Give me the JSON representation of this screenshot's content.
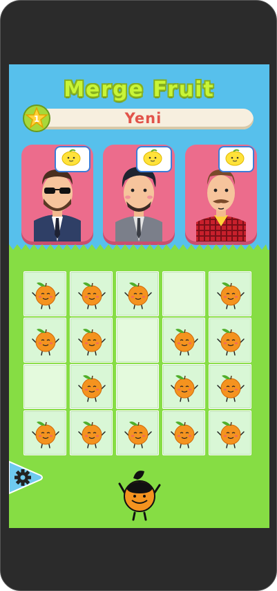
{
  "game": {
    "title": "Merge Fruit",
    "level_number": "1",
    "level_label": "Yeni"
  },
  "customers": [
    {
      "name": "customer-sunglasses",
      "wants": "lemon"
    },
    {
      "name": "customer-dark-hair",
      "wants": "lemon"
    },
    {
      "name": "customer-plaid",
      "wants": "lemon"
    }
  ],
  "board": {
    "columns": 5,
    "rows": 4,
    "cells": [
      [
        "orange",
        "orange",
        "orange",
        "empty",
        "orange"
      ],
      [
        "orange",
        "orange",
        "empty",
        "orange",
        "orange"
      ],
      [
        "empty",
        "orange",
        "empty",
        "orange",
        "orange"
      ],
      [
        "orange",
        "orange",
        "orange",
        "orange",
        "orange"
      ]
    ]
  },
  "icons": {
    "settings": "gear-icon",
    "level_badge": "star-icon",
    "fruit": "orange-icon",
    "order": "lemon-icon"
  },
  "colors": {
    "sky": "#57c0ec",
    "grass": "#86dd44",
    "title": "#c8f536",
    "card": "#ec6c8c",
    "cell": "#d9f7d6",
    "level_text": "#e2534a"
  }
}
